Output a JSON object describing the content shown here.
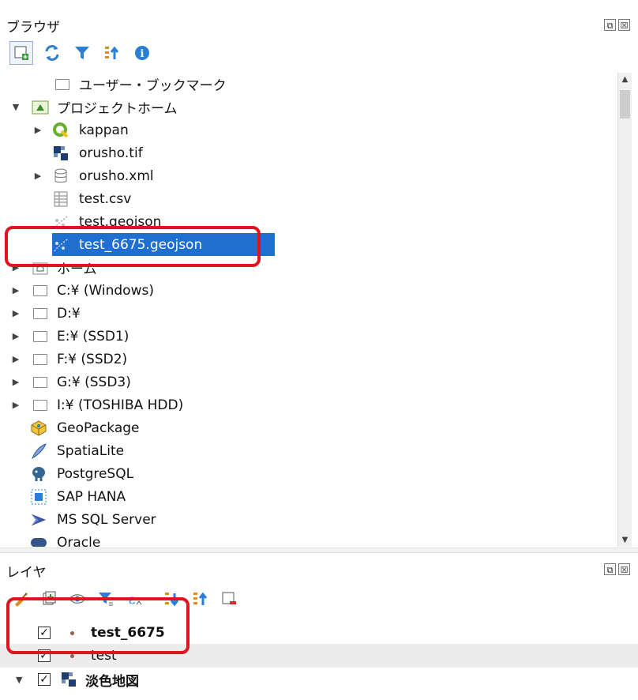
{
  "browser": {
    "title": "ブラウザ",
    "dock_buttons": [
      "⧉",
      "☒"
    ],
    "toolbar": [
      "add-layer-icon",
      "refresh-icon",
      "filter-icon",
      "collapse-all-icon",
      "info-icon"
    ],
    "tree": [
      {
        "label": "ユーザー・ブックマーク",
        "icon": "folder-icon",
        "arrow": ""
      },
      {
        "label": "プロジェクトホーム",
        "icon": "project-home-icon",
        "arrow": "▼"
      },
      {
        "label": "kappan",
        "icon": "qgis-icon",
        "arrow": "▶"
      },
      {
        "label": "orusho.tif",
        "icon": "raster-icon",
        "arrow": ""
      },
      {
        "label": "orusho.xml",
        "icon": "database-icon",
        "arrow": "▶"
      },
      {
        "label": "test.csv",
        "icon": "table-icon",
        "arrow": ""
      },
      {
        "label": "test.geojson",
        "icon": "vector-point-icon",
        "arrow": ""
      },
      {
        "label": "test_6675.geojson",
        "icon": "vector-point-icon",
        "arrow": ""
      },
      {
        "label": "ホーム",
        "icon": "home-folder-icon",
        "arrow": "▶"
      },
      {
        "label": "C:¥ (Windows)",
        "icon": "folder-icon",
        "arrow": "▶"
      },
      {
        "label": "D:¥",
        "icon": "folder-icon",
        "arrow": "▶"
      },
      {
        "label": "E:¥ (SSD1)",
        "icon": "folder-icon",
        "arrow": "▶"
      },
      {
        "label": "F:¥ (SSD2)",
        "icon": "folder-icon",
        "arrow": "▶"
      },
      {
        "label": "G:¥ (SSD3)",
        "icon": "folder-icon",
        "arrow": "▶"
      },
      {
        "label": "I:¥ (TOSHIBA HDD)",
        "icon": "folder-icon",
        "arrow": "▶"
      },
      {
        "label": "GeoPackage",
        "icon": "geopackage-icon",
        "arrow": ""
      },
      {
        "label": "SpatiaLite",
        "icon": "spatialite-icon",
        "arrow": ""
      },
      {
        "label": "PostgreSQL",
        "icon": "postgresql-icon",
        "arrow": ""
      },
      {
        "label": "SAP HANA",
        "icon": "sap-hana-icon",
        "arrow": ""
      },
      {
        "label": "MS SQL Server",
        "icon": "mssql-icon",
        "arrow": ""
      },
      {
        "label": "Oracle",
        "icon": "oracle-icon",
        "arrow": ""
      }
    ],
    "selected_item": "test_6675.geojson"
  },
  "layers": {
    "title": "レイヤ",
    "dock_buttons": [
      "⧉",
      "☒"
    ],
    "toolbar": [
      "style-icon",
      "add-group-icon",
      "visibility-icon",
      "filter-legend-icon",
      "expression-filter-icon",
      "dropdown-icon",
      "expand-all-icon",
      "collapse-all-icon",
      "remove-layer-icon"
    ],
    "items": [
      {
        "label": "test_6675",
        "checked": true,
        "symbol": "point",
        "bold": true
      },
      {
        "label": "test",
        "checked": true,
        "symbol": "point",
        "bold": false
      },
      {
        "label": "淡色地図",
        "checked": true,
        "symbol": "raster",
        "bold": true
      }
    ]
  },
  "colors": {
    "selection": "#1f6fd0",
    "highlight_outline": "#e0141e"
  }
}
